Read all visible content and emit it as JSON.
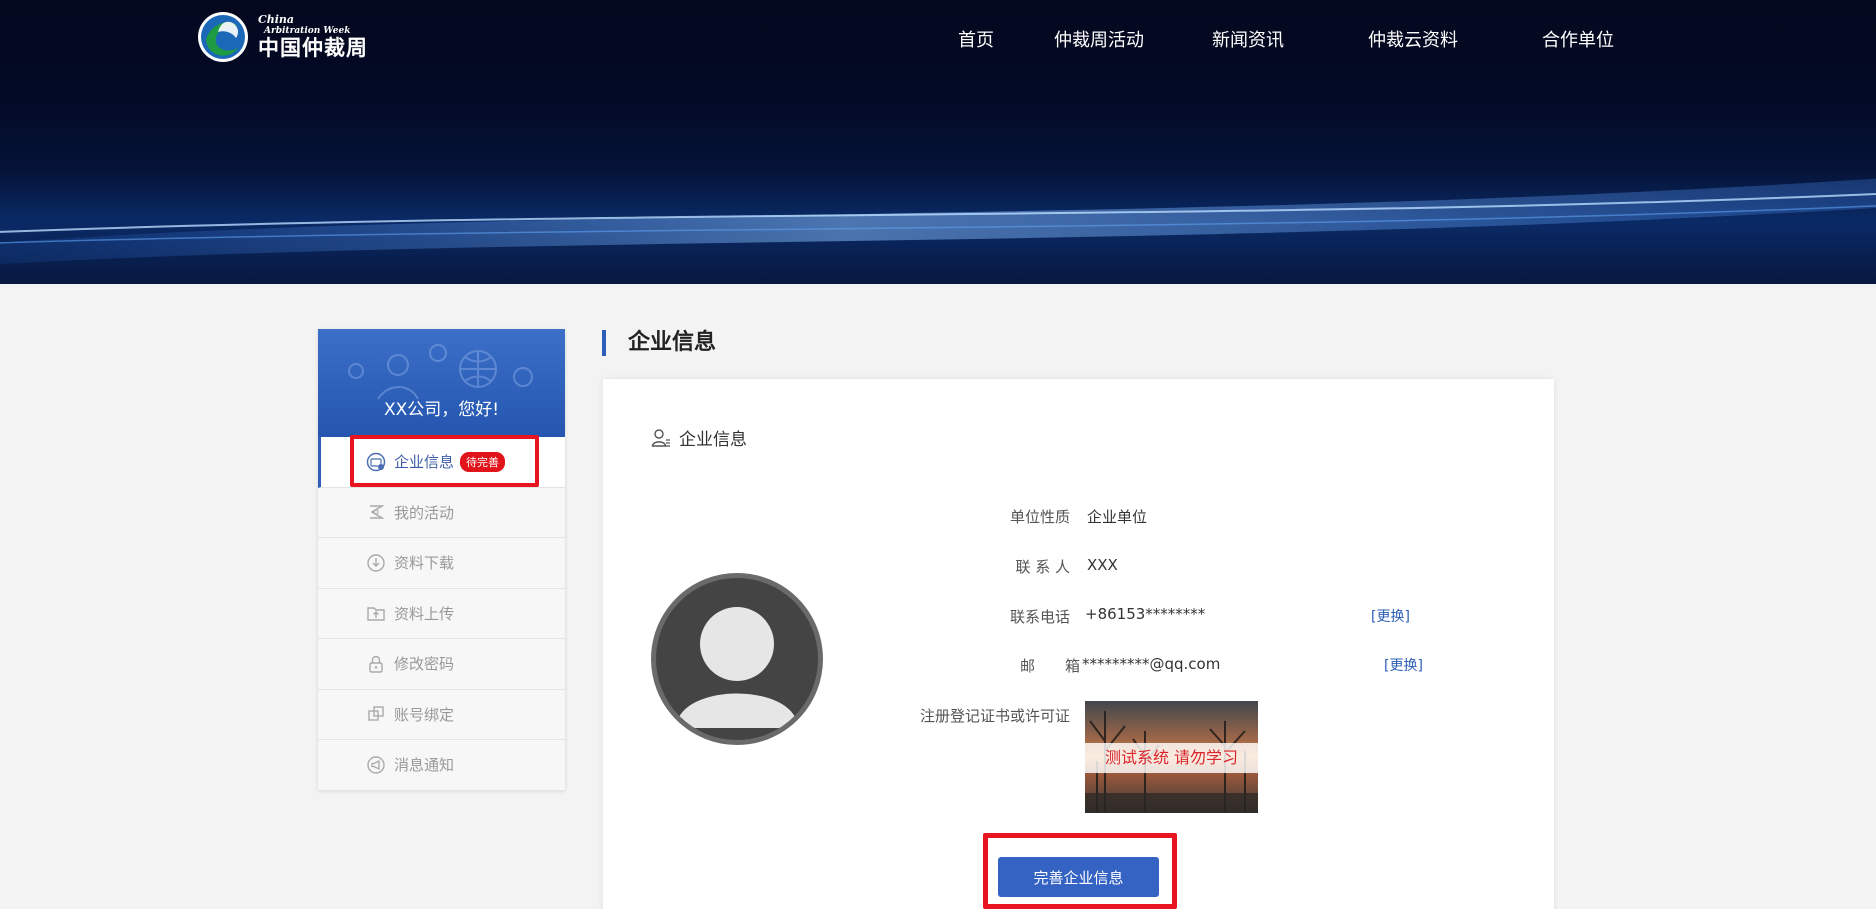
{
  "logo": {
    "en_line1": "China",
    "en_line2": "Arbitration Week",
    "cn": "中国仲裁周"
  },
  "nav": {
    "items": [
      "首页",
      "仲裁周活动",
      "新闻资讯",
      "仲裁云资料",
      "合作单位"
    ]
  },
  "sidebar": {
    "greeting": "XX公司，您好!",
    "items": [
      {
        "label": "企业信息",
        "icon": "enterprise-id-icon",
        "badge": "待完善"
      },
      {
        "label": "我的活动",
        "icon": "activity-icon"
      },
      {
        "label": "资料下载",
        "icon": "download-icon"
      },
      {
        "label": "资料上传",
        "icon": "upload-icon"
      },
      {
        "label": "修改密码",
        "icon": "lock-icon"
      },
      {
        "label": "账号绑定",
        "icon": "link-icon"
      },
      {
        "label": "消息通知",
        "icon": "megaphone-icon"
      }
    ]
  },
  "main": {
    "section_title": "企业信息",
    "card_title": "企业信息",
    "fields": {
      "unit_type_label": "单位性质",
      "unit_type_value": "企业单位",
      "contact_label": "联 系 人",
      "contact_value": "XXX",
      "phone_label": "联系电话",
      "phone_value": "+86153********",
      "email_label": "邮　　箱",
      "email_value": "*********@qq.com",
      "cert_label": "注册登记证书或许可证",
      "cert_watermark": "测试系统  请勿学习",
      "change_label": "[更换]"
    },
    "complete_button": "完善企业信息"
  },
  "colors": {
    "accent": "#2d5fb8",
    "highlight": "#e8141f",
    "badge": "#e0141a"
  }
}
